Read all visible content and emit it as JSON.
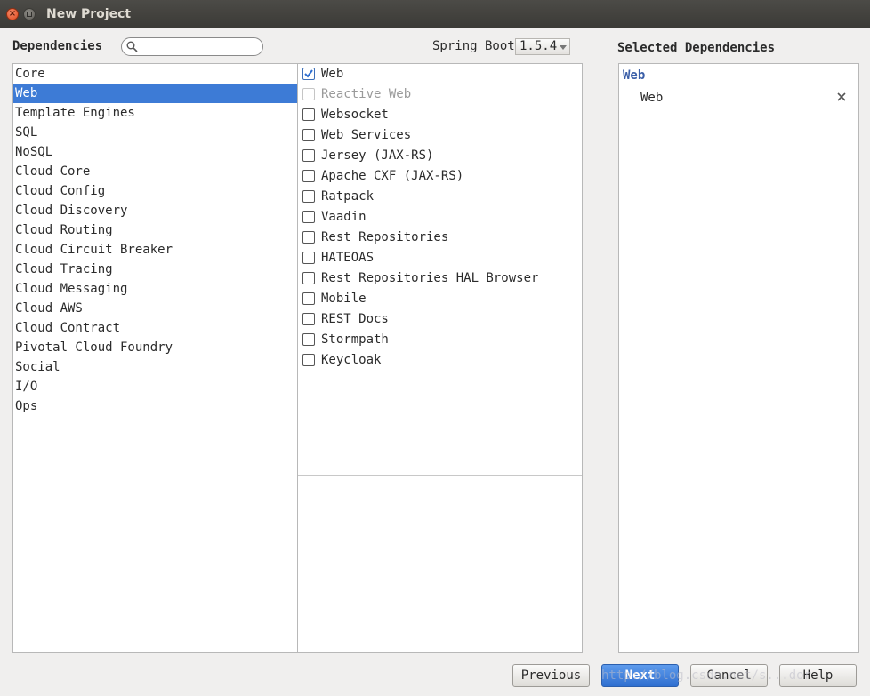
{
  "window": {
    "title": "New Project"
  },
  "dependencies": {
    "label": "Dependencies",
    "search_placeholder": "",
    "spring_boot_label": "Spring Boot",
    "spring_boot_version": "1.5.4"
  },
  "categories": [
    {
      "label": "Core",
      "selected": false
    },
    {
      "label": "Web",
      "selected": true
    },
    {
      "label": "Template Engines",
      "selected": false
    },
    {
      "label": "SQL",
      "selected": false
    },
    {
      "label": "NoSQL",
      "selected": false
    },
    {
      "label": "Cloud Core",
      "selected": false
    },
    {
      "label": "Cloud Config",
      "selected": false
    },
    {
      "label": "Cloud Discovery",
      "selected": false
    },
    {
      "label": "Cloud Routing",
      "selected": false
    },
    {
      "label": "Cloud Circuit Breaker",
      "selected": false
    },
    {
      "label": "Cloud Tracing",
      "selected": false
    },
    {
      "label": "Cloud Messaging",
      "selected": false
    },
    {
      "label": "Cloud AWS",
      "selected": false
    },
    {
      "label": "Cloud Contract",
      "selected": false
    },
    {
      "label": "Pivotal Cloud Foundry",
      "selected": false
    },
    {
      "label": "Social",
      "selected": false
    },
    {
      "label": "I/O",
      "selected": false
    },
    {
      "label": "Ops",
      "selected": false
    }
  ],
  "dependency_items": [
    {
      "label": "Web",
      "checked": true,
      "disabled": false
    },
    {
      "label": "Reactive Web",
      "checked": false,
      "disabled": true
    },
    {
      "label": "Websocket",
      "checked": false,
      "disabled": false
    },
    {
      "label": "Web Services",
      "checked": false,
      "disabled": false
    },
    {
      "label": "Jersey (JAX-RS)",
      "checked": false,
      "disabled": false
    },
    {
      "label": "Apache CXF (JAX-RS)",
      "checked": false,
      "disabled": false
    },
    {
      "label": "Ratpack",
      "checked": false,
      "disabled": false
    },
    {
      "label": "Vaadin",
      "checked": false,
      "disabled": false
    },
    {
      "label": "Rest Repositories",
      "checked": false,
      "disabled": false
    },
    {
      "label": "HATEOAS",
      "checked": false,
      "disabled": false
    },
    {
      "label": "Rest Repositories HAL Browser",
      "checked": false,
      "disabled": false
    },
    {
      "label": "Mobile",
      "checked": false,
      "disabled": false
    },
    {
      "label": "REST Docs",
      "checked": false,
      "disabled": false
    },
    {
      "label": "Stormpath",
      "checked": false,
      "disabled": false
    },
    {
      "label": "Keycloak",
      "checked": false,
      "disabled": false
    }
  ],
  "selected": {
    "title": "Selected Dependencies",
    "group": "Web",
    "item": "Web"
  },
  "buttons": {
    "previous": "Previous",
    "next": "Next",
    "cancel": "Cancel",
    "help": "Help"
  },
  "watermark": "http://blog.csdn.net/s...dor",
  "colors": {
    "selection": "#3d7bd6",
    "primary_button": "#2f6fd0",
    "group_heading": "#3b5fa8",
    "close_button": "#df4a1e"
  }
}
